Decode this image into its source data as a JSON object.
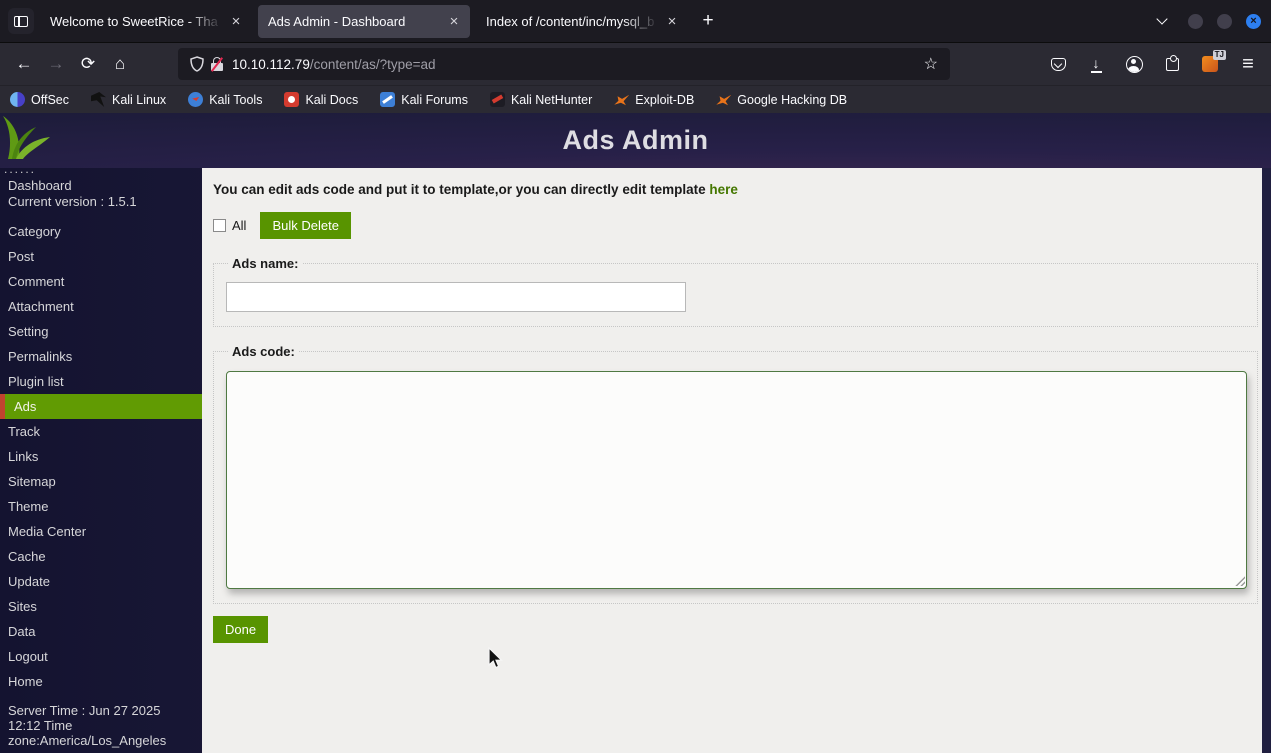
{
  "browser": {
    "tabs": [
      {
        "title": "Welcome to SweetRice - Tha",
        "active": false
      },
      {
        "title": "Ads Admin - Dashboard",
        "active": true
      },
      {
        "title": "Index of /content/inc/mysql_b",
        "active": false
      }
    ],
    "url": {
      "host": "10.10.112.79",
      "path": "/content/as/?type=ad"
    },
    "extension_badge": "TJ",
    "bookmarks": [
      {
        "label": "OffSec"
      },
      {
        "label": "Kali Linux"
      },
      {
        "label": "Kali Tools"
      },
      {
        "label": "Kali Docs"
      },
      {
        "label": "Kali Forums"
      },
      {
        "label": "Kali NetHunter"
      },
      {
        "label": "Exploit-DB"
      },
      {
        "label": "Google Hacking DB"
      }
    ]
  },
  "icons": {
    "close_tab": "×",
    "new_tab": "+",
    "back": "←",
    "forward": "→",
    "reload": "⟳",
    "home": "⌂",
    "star": "☆",
    "download_arrow": "↓",
    "menu": "≡",
    "win_close": "×"
  },
  "page": {
    "header_title": "Ads Admin",
    "sidebar": {
      "dashboard": "Dashboard",
      "version": "Current version : 1.5.1",
      "logo_dots": "......",
      "items": [
        "Category",
        "Post",
        "Comment",
        "Attachment",
        "Setting",
        "Permalinks",
        "Plugin list",
        "Ads",
        "Track",
        "Links",
        "Sitemap",
        "Theme",
        "Media Center",
        "Cache",
        "Update",
        "Sites",
        "Data",
        "Logout",
        "Home"
      ],
      "active_item": "Ads",
      "server_time": "Server Time : Jun 27 2025 12:12 Time zone:America/Los_Angeles"
    },
    "main": {
      "intro_text": "You can edit ads code and put it to template,or you can directly edit template ",
      "intro_link": "here",
      "all_label": "All",
      "bulk_delete_label": "Bulk Delete",
      "ads_name_legend": "Ads name:",
      "ads_name_value": "",
      "ads_code_legend": "Ads code:",
      "ads_code_value": "",
      "done_label": "Done"
    },
    "colors": {
      "accent_green": "#589400",
      "active_item_green": "#619b03",
      "active_item_red_bar": "#c0432f",
      "link_green": "#447700",
      "sidebar_navy": "#1e1d3d"
    }
  }
}
